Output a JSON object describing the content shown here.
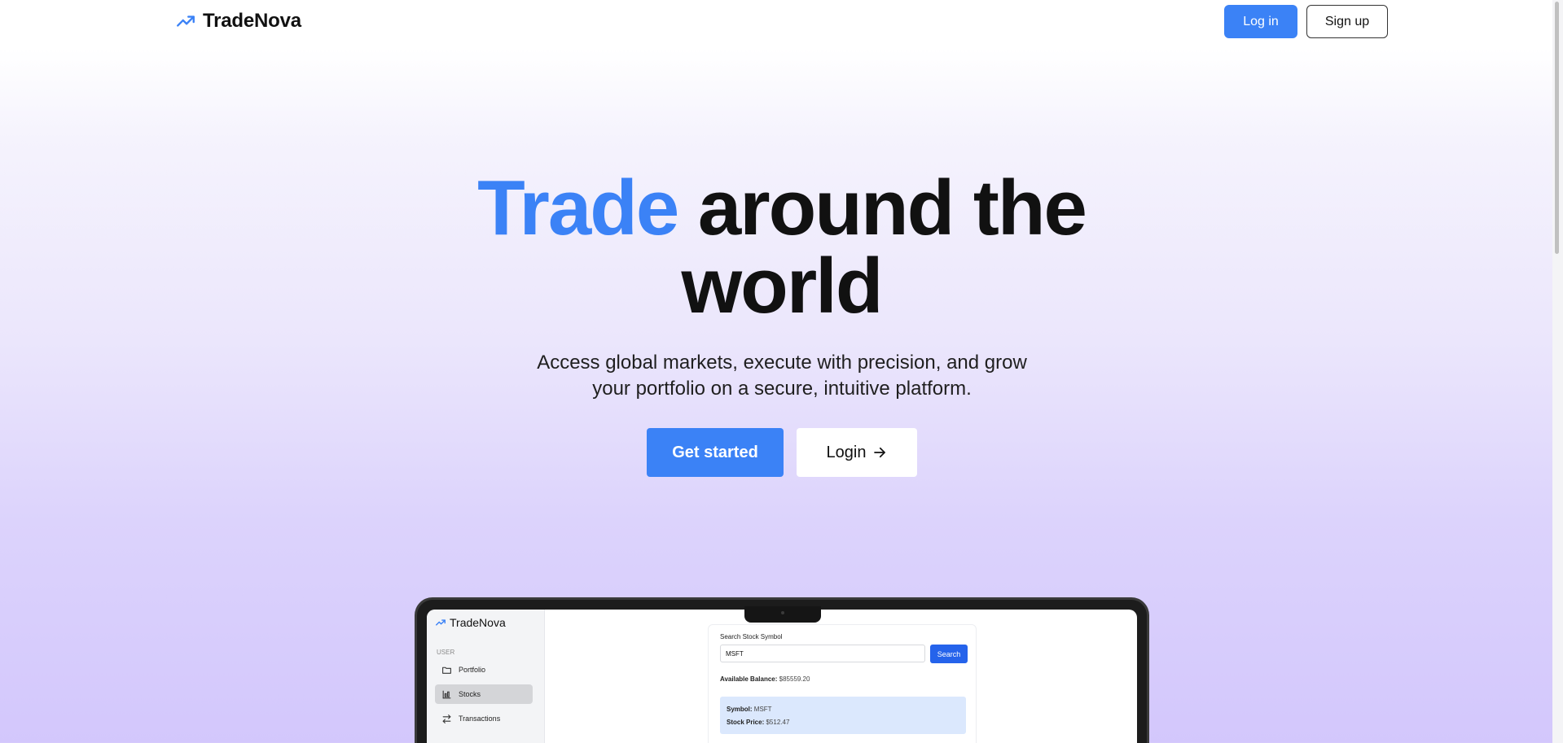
{
  "header": {
    "brand": "TradeNova",
    "login_label": "Log in",
    "signup_label": "Sign up"
  },
  "hero": {
    "title_accent": "Trade",
    "title_rest_1": "around the",
    "title_rest_2": "world",
    "subtitle_line1": "Access global markets, execute with precision, and grow",
    "subtitle_line2": "your portfolio on a secure, intuitive platform.",
    "cta_primary": "Get started",
    "cta_secondary": "Login"
  },
  "preview": {
    "brand": "TradeNova",
    "section_label": "USER",
    "nav": [
      {
        "label": "Portfolio",
        "icon": "folder-icon"
      },
      {
        "label": "Stocks",
        "icon": "chart-icon"
      },
      {
        "label": "Transactions",
        "icon": "swap-icon"
      }
    ],
    "search_label": "Search Stock Symbol",
    "search_value": "MSFT",
    "search_button": "Search",
    "balance_label": "Available Balance:",
    "balance_value": "$85559.20",
    "symbol_label": "Symbol:",
    "symbol_value": "MSFT",
    "price_label": "Stock Price:",
    "price_value": "$512.47"
  },
  "colors": {
    "accent": "#3b82f6",
    "text": "#111111"
  }
}
